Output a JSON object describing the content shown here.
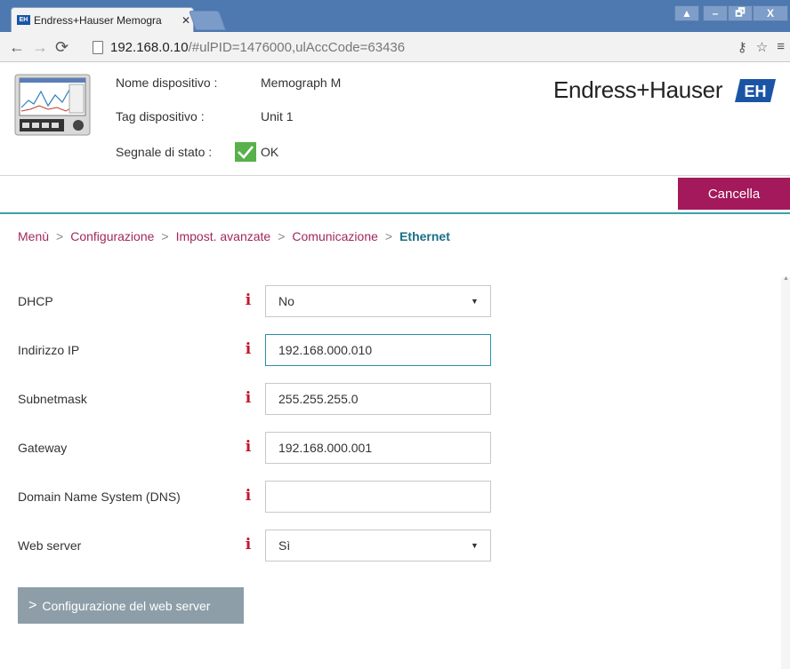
{
  "browser": {
    "tab_title": "Endress+Hauser Memogra",
    "tab_favicon_text": "EH",
    "url_host": "192.168.0.10",
    "url_path": "/#ulPID=1476000,ulAccCode=63436",
    "window_controls": [
      "▲",
      "–",
      "🗗",
      "X"
    ]
  },
  "header": {
    "device_name_label": "Nome dispositivo :",
    "device_name_value": "Memograph M",
    "device_tag_label": "Tag dispositivo :",
    "device_tag_value": "Unit 1",
    "status_label": "Segnale di stato :",
    "status_value": "OK",
    "logo_text": "Endress+Hauser",
    "logo_mark_text": "EH",
    "brand_color": "#1a55a5",
    "cancel_label": "Cancella",
    "cancel_color": "#a3195b"
  },
  "breadcrumb": {
    "items": [
      "Menù",
      "Configurazione",
      "Impost. avanzate",
      "Comunicazione"
    ],
    "separator": ">",
    "current": "Ethernet"
  },
  "form": {
    "rows": [
      {
        "label": "DHCP",
        "type": "select",
        "value": "No"
      },
      {
        "label": "Indirizzo IP",
        "type": "input",
        "value": "192.168.000.010"
      },
      {
        "label": "Subnetmask",
        "type": "input",
        "value": "255.255.255.0"
      },
      {
        "label": "Gateway",
        "type": "input",
        "value": "192.168.000.001"
      },
      {
        "label": "Domain Name System (DNS)",
        "type": "input",
        "value": ""
      },
      {
        "label": "Web server",
        "type": "select",
        "value": "Sì"
      }
    ],
    "info_icon_glyph": "i",
    "select_caret": "▼"
  },
  "web_server_button": {
    "chevron": ">",
    "label": "Configurazione del web server"
  }
}
